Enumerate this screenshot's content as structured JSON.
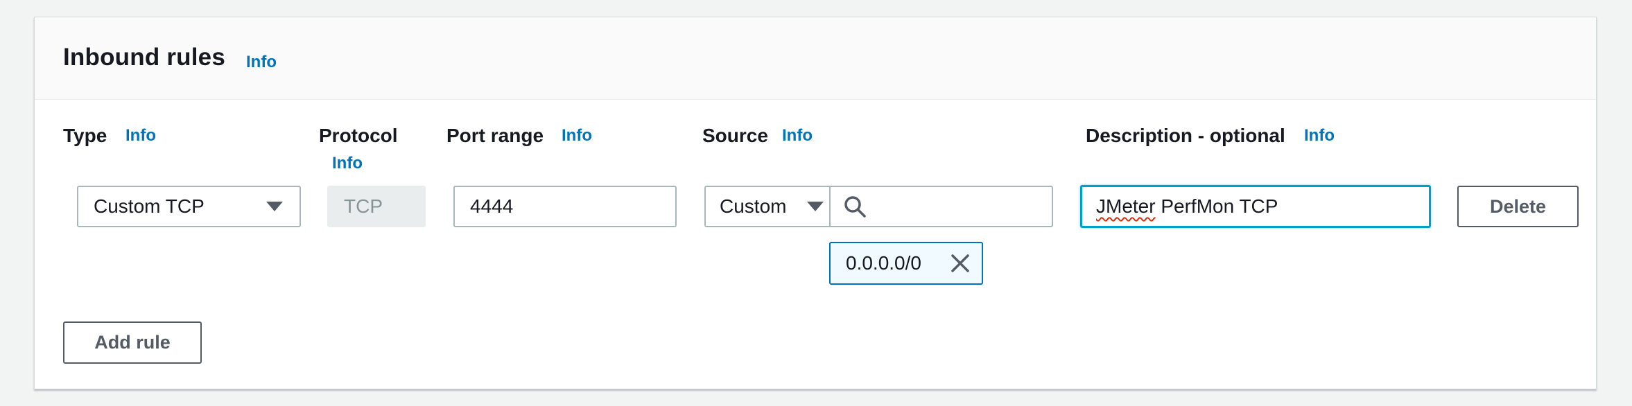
{
  "section": {
    "title": "Inbound rules",
    "info": "Info"
  },
  "columns": {
    "type": {
      "label": "Type",
      "info": "Info"
    },
    "protocol": {
      "label": "Protocol",
      "info": "Info"
    },
    "port_range": {
      "label": "Port range",
      "info": "Info"
    },
    "source": {
      "label": "Source",
      "info": "Info"
    },
    "description": {
      "label": "Description - optional",
      "info": "Info"
    }
  },
  "rule": {
    "type_value": "Custom TCP",
    "protocol_value": "TCP",
    "port_value": "4444",
    "source_select": "Custom",
    "source_search_value": "",
    "source_token": "0.0.0.0/0",
    "description_first": "JMeter",
    "description_rest": " PerfMon TCP",
    "delete_label": "Delete"
  },
  "add_rule_label": "Add rule",
  "icons": {
    "select_arrow": "caret-down-icon",
    "search": "search-icon",
    "remove_token": "close-icon"
  },
  "colors": {
    "link": "#0073bb",
    "focus": "#00a1c9",
    "token_bg": "#f1faff",
    "disabled_bg": "#eaeded",
    "spellcheck": "#d13212"
  }
}
